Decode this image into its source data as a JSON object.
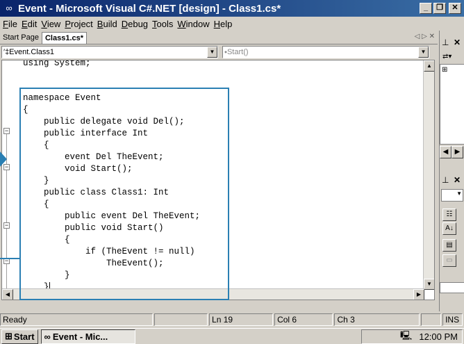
{
  "window": {
    "title": "Event - Microsoft Visual C#.NET [design] - Class1.cs*",
    "minimize": "_",
    "restore": "❐",
    "close": "✕",
    "app_icon": "vs-infinity-icon"
  },
  "menu": [
    {
      "first": "F",
      "rest": "ile"
    },
    {
      "first": "E",
      "rest": "dit"
    },
    {
      "first": "V",
      "rest": "iew"
    },
    {
      "first": "P",
      "rest": "roject"
    },
    {
      "first": "B",
      "rest": "uild"
    },
    {
      "first": "D",
      "rest": "ebug"
    },
    {
      "first": "T",
      "rest": "ools"
    },
    {
      "first": "W",
      "rest": "indow"
    },
    {
      "first": "H",
      "rest": "elp"
    }
  ],
  "tabs": {
    "items": [
      "Start Page",
      "Class1.cs*"
    ],
    "active": "Class1.cs*",
    "controls": "◁ ▷ ✕"
  },
  "nav": {
    "type_combo": "′‡Event.Class1",
    "member_combo": "⬩Start()"
  },
  "code": {
    "lines": [
      "using System;",
      "",
      "namespace Event",
      "{",
      "    public delegate void Del();",
      "    public interface Int",
      "    {",
      "        event Del TheEvent;",
      "        void Start();",
      "    }",
      "    public class Class1: Int",
      "    {",
      "        public event Del TheEvent;",
      "        public void Start()",
      "        {",
      "            if (TheEvent != null)",
      "                TheEvent();",
      "        }",
      "    }"
    ]
  },
  "status": {
    "ready": "Ready",
    "line": "Ln 19",
    "col": "Col 6",
    "ch": "Ch 3",
    "ins": "INS"
  },
  "taskbar": {
    "start": "Start",
    "task": "Event - Mic...",
    "clock": "12:00 PM"
  },
  "accent": "#2a7fb3"
}
